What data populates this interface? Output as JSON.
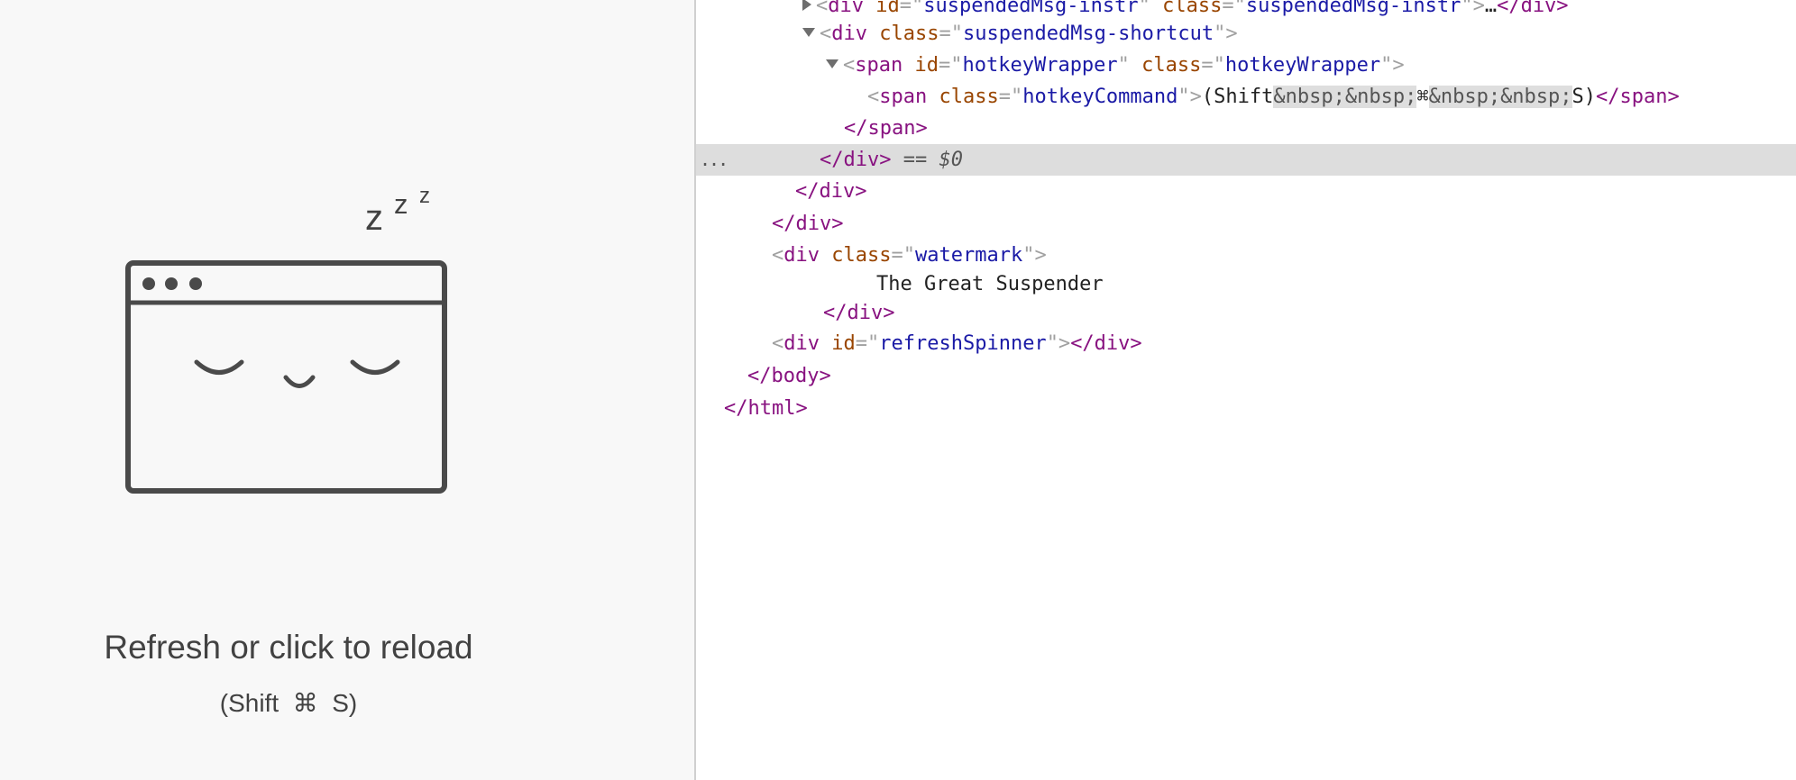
{
  "suspended_page": {
    "reload_text": "Refresh or click to reload",
    "hotkey": "(Shift  ⌘  S)",
    "zzz": [
      "z",
      "z",
      "z"
    ]
  },
  "dom": {
    "l0_open": "<",
    "l0_tag": "div",
    "l0_attr1": "id",
    "l0_val1": "suspendedMsg-instr",
    "l0_attr2": "class",
    "l0_val2": "suspendedMsg-instr",
    "l0_ellipsis": "…",
    "l0_close": "</div>",
    "l1_tag": "div",
    "l1_attr": "class",
    "l1_val": "suspendedMsg-shortcut",
    "l2_tag": "span",
    "l2_attr1": "id",
    "l2_val1": "hotkeyWrapper",
    "l2_attr2": "class",
    "l2_val2": "hotkeyWrapper",
    "l3_tag": "span",
    "l3_attr": "class",
    "l3_val": "hotkeyCommand",
    "l3_text1": "(Shift",
    "l3_nbsp1": "&nbsp;&nbsp;",
    "l3_cmd": "⌘",
    "l3_nbsp2": "&nbsp;&nbsp;",
    "l3_text2": "S)",
    "l3_close": "</span>",
    "l4_close": "</span>",
    "l5_close": "</div>",
    "l5_eq": "==",
    "l5_dollar": "$0",
    "l5_dots": "...",
    "l6_close": "</div>",
    "l7_close": "</div>",
    "l8_tag": "div",
    "l8_attr": "class",
    "l8_val": "watermark",
    "l9_text": "The Great Suspender",
    "l10_close": "</div>",
    "l11_tag": "div",
    "l11_attr": "id",
    "l11_val": "refreshSpinner",
    "l11_close": "</div>",
    "l12_close": "</body>",
    "l13_close": "</html>"
  }
}
